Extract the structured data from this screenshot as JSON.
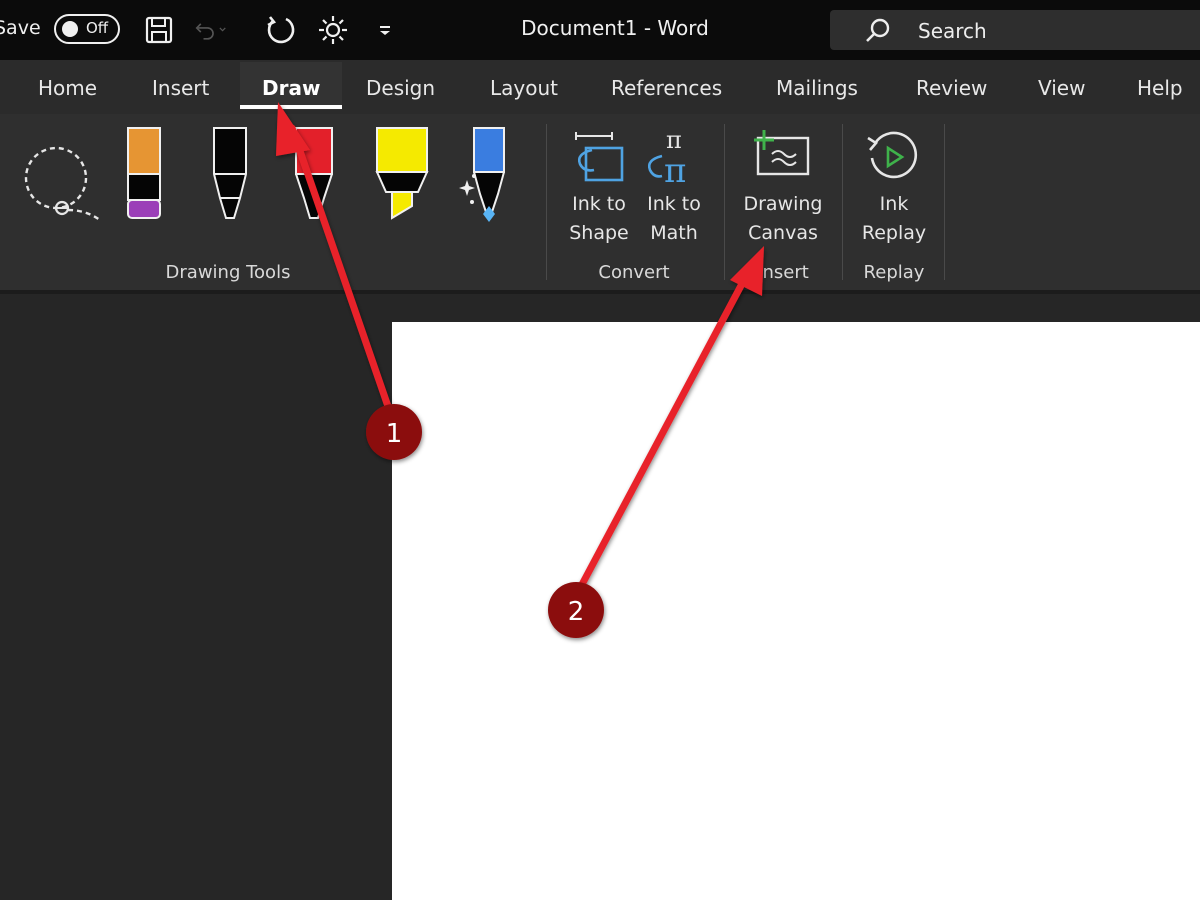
{
  "titlebar": {
    "autosave_label": "Save",
    "autosave_state": "Off",
    "document_title": "Document1  -  Word",
    "search_placeholder": "Search",
    "icons": [
      "save-icon",
      "undo-icon",
      "redo-icon",
      "touch-mode-icon",
      "customize-qat-icon",
      "search-icon"
    ]
  },
  "tabs": [
    {
      "label": "Home"
    },
    {
      "label": "Insert"
    },
    {
      "label": "Draw",
      "active": true
    },
    {
      "label": "Design"
    },
    {
      "label": "Layout"
    },
    {
      "label": "References"
    },
    {
      "label": "Mailings"
    },
    {
      "label": "Review"
    },
    {
      "label": "View"
    },
    {
      "label": "Help"
    }
  ],
  "ribbon": {
    "groups": [
      {
        "label": "Drawing Tools",
        "tools": [
          "lasso-select-icon",
          "pencil-orange-icon",
          "pen-black-icon",
          "pen-red-icon",
          "highlighter-yellow-icon",
          "action-pen-blue-icon"
        ]
      },
      {
        "label": "Convert",
        "buttons": [
          {
            "line1": "Ink to",
            "line2": "Shape"
          },
          {
            "line1": "Ink to",
            "line2": "Math"
          }
        ]
      },
      {
        "label": "Insert",
        "buttons": [
          {
            "line1": "Drawing",
            "line2": "Canvas"
          }
        ]
      },
      {
        "label": "Replay",
        "buttons": [
          {
            "line1": "Ink",
            "line2": "Replay"
          }
        ]
      }
    ]
  },
  "annotations": [
    {
      "number": "1",
      "target": "Draw tab"
    },
    {
      "number": "2",
      "target": "Drawing Canvas button"
    }
  ],
  "colors": {
    "titlebar": "#0b0b0b",
    "ribbon": "#2f2f2f",
    "page": "#ffffff",
    "arrow": "#e8242a",
    "badge": "#8b1010"
  }
}
